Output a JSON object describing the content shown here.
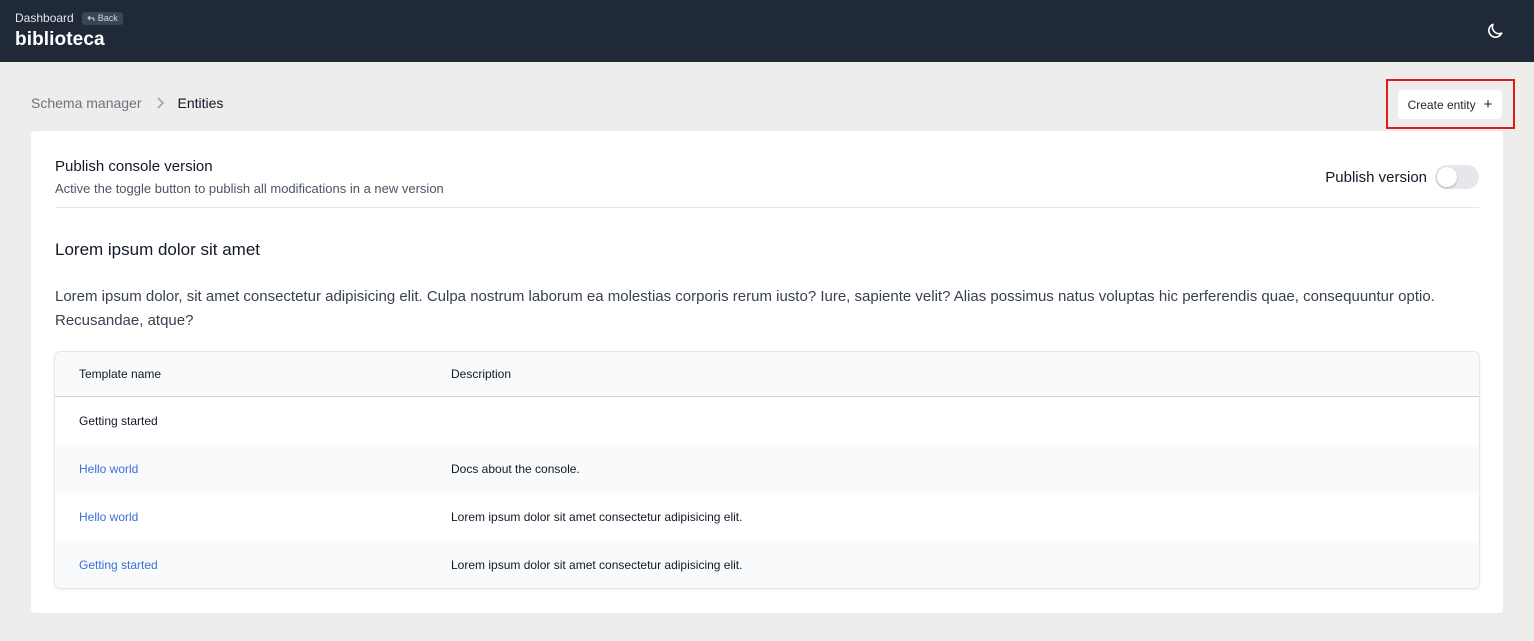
{
  "header": {
    "breadcrumb": "Dashboard",
    "back_label": "Back",
    "app_title": "biblioteca",
    "theme_icon": "moon-icon"
  },
  "breadcrumb": {
    "parent": "Schema manager",
    "current": "Entities"
  },
  "actions": {
    "create_label": "Create entity",
    "create_icon": "+"
  },
  "publish": {
    "title": "Publish console version",
    "subtitle": "Active the toggle button to publish all modifications in a new version",
    "toggle_label": "Publish version",
    "toggle_on": false
  },
  "section": {
    "title": "Lorem ipsum dolor sit amet",
    "body": "Lorem ipsum dolor, sit amet consectetur adipisicing elit. Culpa nostrum laborum ea molestias corporis rerum iusto? Iure, sapiente velit? Alias possimus natus voluptas hic perferendis quae, consequuntur optio. Recusandae, atque?"
  },
  "table": {
    "headers": [
      "Template name",
      "Description"
    ],
    "rows": [
      {
        "name": "Getting started",
        "description": "",
        "is_link": false
      },
      {
        "name": "Hello world",
        "description": "Docs about the console.",
        "is_link": true
      },
      {
        "name": "Hello world",
        "description": "Lorem ipsum dolor sit amet consectetur adipisicing elit.",
        "is_link": true
      },
      {
        "name": "Getting started",
        "description": "Lorem ipsum dolor sit amet consectetur adipisicing elit.",
        "is_link": true
      }
    ]
  },
  "colors": {
    "topbar": "#1f2937",
    "link": "#3b6fd8",
    "highlight": "#e01b1b",
    "page_bg": "#ededeb"
  }
}
